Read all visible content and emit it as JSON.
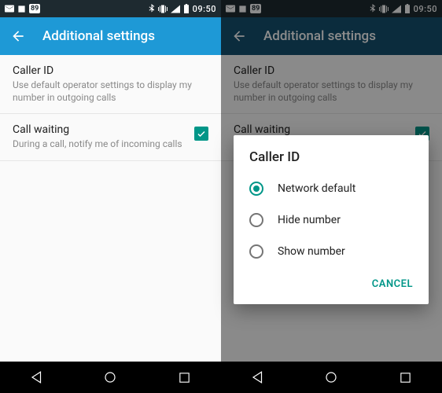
{
  "statusbar": {
    "battery_level": "89",
    "clock": "09:50"
  },
  "appbar": {
    "title": "Additional settings"
  },
  "settings": {
    "caller_id": {
      "title": "Caller ID",
      "subtitle": "Use default operator settings to display my number in outgoing calls"
    },
    "call_waiting": {
      "title": "Call waiting",
      "subtitle": "During a call, notify me of incoming calls",
      "checked": true
    }
  },
  "dialog": {
    "title": "Caller ID",
    "options": [
      "Network default",
      "Hide number",
      "Show number"
    ],
    "selected_index": 0,
    "cancel": "CANCEL"
  },
  "colors": {
    "accent": "#009688",
    "appbar": "#1e99d6"
  }
}
